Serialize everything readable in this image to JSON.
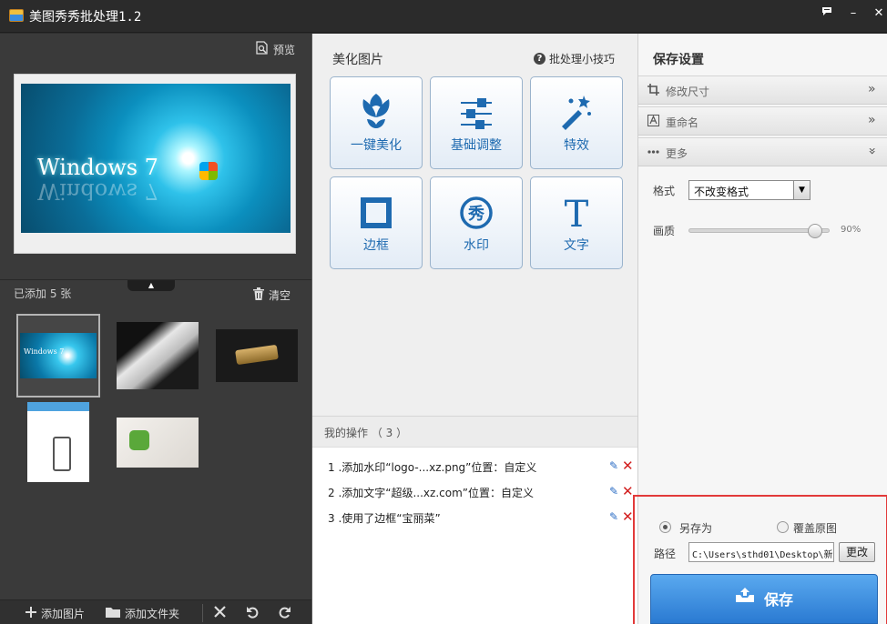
{
  "window": {
    "title": "美图秀秀批处理1.2",
    "controls": {
      "feedback": "feedback-icon",
      "minimize": "–",
      "close": "✕"
    }
  },
  "left_panel": {
    "preview_label": "预览",
    "preview_image_text": "Windows 7",
    "added_count_label": "已添加 5 张",
    "clear_label": "清空",
    "thumbnails": [
      {
        "name": "windows7-wallpaper",
        "text": "Windows 7",
        "selected": true
      },
      {
        "name": "white-phone"
      },
      {
        "name": "gold-usb-drive"
      },
      {
        "name": "webpage-screenshot"
      },
      {
        "name": "wechat-product"
      }
    ],
    "bottom_bar": {
      "add_image_label": "添加图片",
      "add_folder_label": "添加文件夹"
    }
  },
  "middle_panel": {
    "beautify_title": "美化图片",
    "tips_label": "批处理小技巧",
    "tools": [
      {
        "label": "一键美化",
        "icon": "tulip-icon"
      },
      {
        "label": "基础调整",
        "icon": "sliders-icon"
      },
      {
        "label": "特效",
        "icon": "magic-wand-icon"
      },
      {
        "label": "边框",
        "icon": "frame-icon"
      },
      {
        "label": "水印",
        "icon": "watermark-icon"
      },
      {
        "label": "文字",
        "icon": "text-t-icon"
      }
    ],
    "watermark_glyph": "秀",
    "text_glyph": "T",
    "operations_title": "我的操作 （ 3 ）",
    "operations": [
      {
        "text": "1 .添加水印“logo-...xz.png”位置：自定义"
      },
      {
        "text": "2 .添加文字“超级...xz.com”位置：自定义"
      },
      {
        "text": "3 .使用了边框“宝丽菜”"
      }
    ]
  },
  "right_panel": {
    "title": "保存设置",
    "accordion": [
      {
        "label": "修改尺寸",
        "icon": "crop-icon",
        "chevron": "»"
      },
      {
        "label": "重命名",
        "icon": "rename-icon",
        "chevron": "»"
      },
      {
        "label": "更多",
        "icon": "more-icon",
        "chevron": "»"
      }
    ],
    "format_label": "格式",
    "format_value": "不改变格式",
    "quality_label": "画质",
    "quality_value": "90%",
    "quality_fraction": 0.9,
    "save_as_label": "另存为",
    "overwrite_label": "覆盖原图",
    "save_as_selected": true,
    "path_label": "路径",
    "path_value": "C:\\Users\\sthd01\\Desktop\\新",
    "change_label": "更改",
    "save_label": "保存"
  },
  "colors": {
    "accent": "#2a7ad2",
    "tool_text": "#1e6ab0",
    "delete": "#d21e1e",
    "highlight_border": "#e23a3a"
  }
}
